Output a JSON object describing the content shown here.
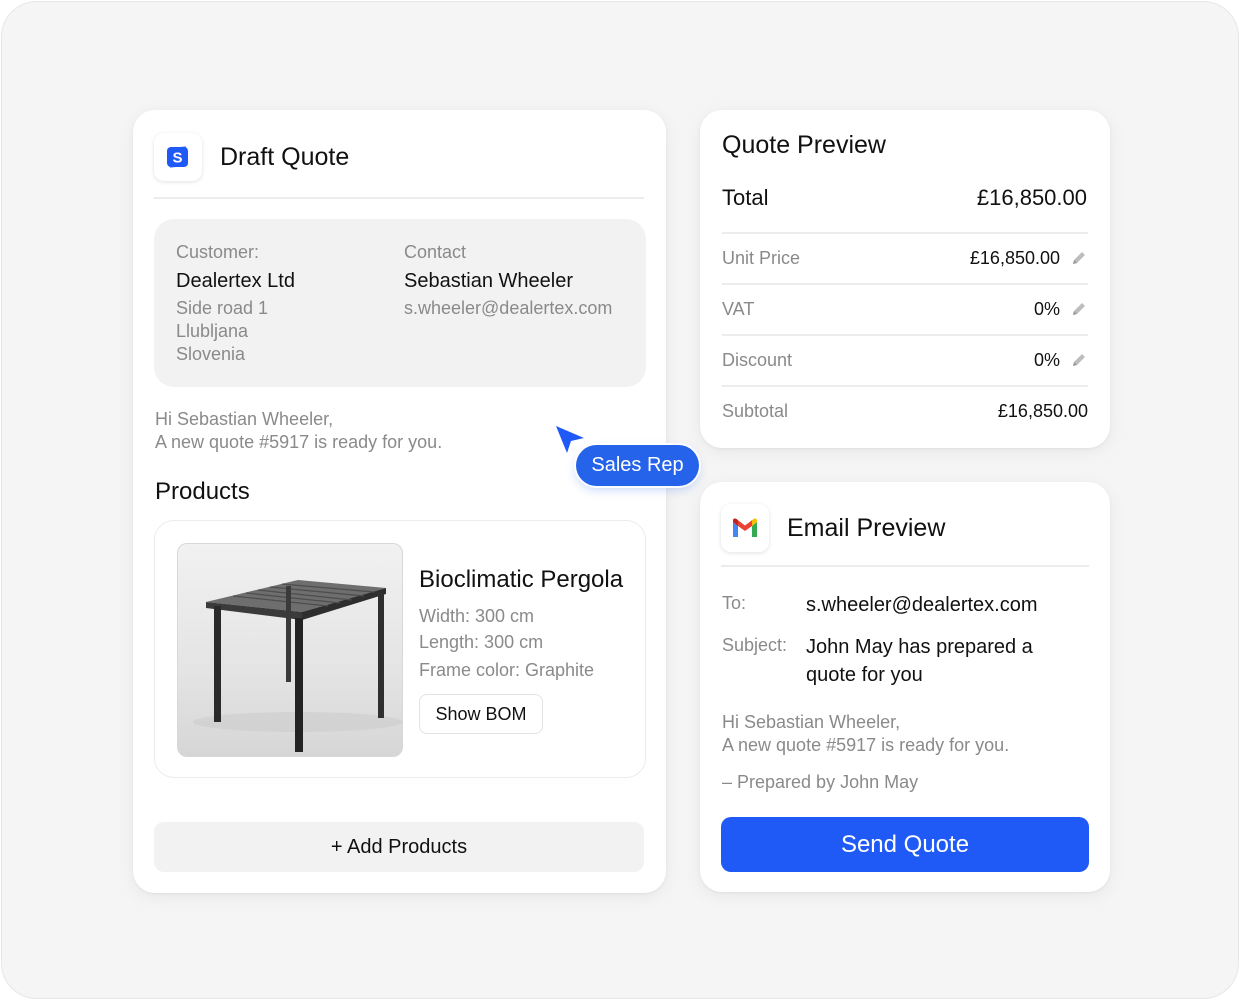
{
  "colors": {
    "accent": "#1f5af6",
    "tag": "#2563eb",
    "muted_text": "#8a8a8a",
    "panel_bg": "#f2f2f2"
  },
  "draft": {
    "app_icon": "s-logo-icon",
    "title": "Draft Quote",
    "customer": {
      "label": "Customer:",
      "name": "Dealertex Ltd",
      "address_1": "Side road 1",
      "address_2": "Llubljana",
      "address_3": "Slovenia"
    },
    "contact": {
      "label": "Contact",
      "name": "Sebastian Wheeler",
      "email": "s.wheeler@dealertex.com"
    },
    "greeting_line_1": "Hi Sebastian Wheeler,",
    "greeting_line_2": "A new quote #5917 is ready for you.",
    "products_title": "Products",
    "product": {
      "name": "Bioclimatic Pergola",
      "width": "Width: 300 cm",
      "length": "Length: 300 cm",
      "frame_color": "Frame color: Graphite",
      "bom_button": "Show BOM"
    },
    "add_products": "+ Add Products"
  },
  "cursor_tag": "Sales Rep",
  "preview": {
    "title": "Quote Preview",
    "total_label": "Total",
    "total_value": "£16,850.00",
    "rows": [
      {
        "label": "Unit Price",
        "value": "£16,850.00",
        "editable": true
      },
      {
        "label": "VAT",
        "value": "0%",
        "editable": true
      },
      {
        "label": "Discount",
        "value": "0%",
        "editable": true
      },
      {
        "label": "Subtotal",
        "value": "£16,850.00",
        "editable": false
      }
    ]
  },
  "email": {
    "app_icon": "gmail-icon",
    "title": "Email Preview",
    "to_label": "To:",
    "to_value": "s.wheeler@dealertex.com",
    "subject_label": "Subject:",
    "subject_value": "John May has prepared a quote for you",
    "body_line_1": "Hi Sebastian Wheeler,",
    "body_line_2": "A new quote #5917 is ready for you.",
    "signature": "– Prepared by John May",
    "send_button": "Send Quote"
  }
}
